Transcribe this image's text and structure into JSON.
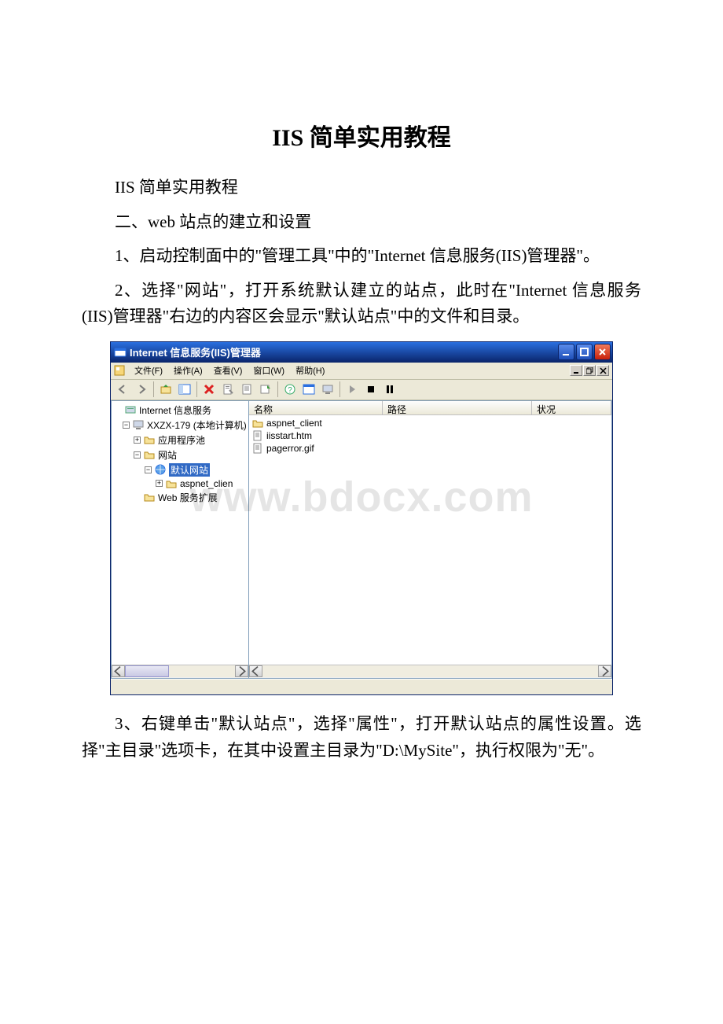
{
  "doc": {
    "title_lat": "IIS",
    "title_cn": " 简单实用教程",
    "p1_lat": "IIS",
    "p1_cn": " 简单实用教程",
    "p2_prefix": "二、",
    "p2_lat": "web",
    "p2_cn": " 站点的建立和设置",
    "p3_a": "1、启动控制面中的\"管理工具\"中的\"",
    "p3_lat": "Internet",
    "p3_b": " 信息服务(",
    "p3_lat2": "IIS",
    "p3_c": ")管理器\"。",
    "p4_a": "2、选择\"网站\"，打开系统默认建立的站点，此时在\"",
    "p4_lat": "Internet",
    "p4_b": " 信息服务(",
    "p4_lat2": "IIS",
    "p4_c": ")管理器\"右边的内容区会显示\"默认站点\"中的文件和目录。",
    "p5_a": "3、右键单击\"默认站点\"，选择\"属性\"，打开默认站点的属性设置。选择\"主目录\"选项卡，在其中设置主目录为\"",
    "p5_lat": "D:\\MySite",
    "p5_b": "\"，执行权限为\"无\"。"
  },
  "watermark": "www.bdocx.com",
  "window": {
    "title": "Internet 信息服务(IIS)管理器",
    "menus": {
      "file": "文件(F)",
      "action": "操作(A)",
      "view": "查看(V)",
      "window": "窗口(W)",
      "help": "帮助(H)"
    },
    "tree": {
      "root": "Internet 信息服务",
      "computer": "XXZX-179 (本地计算机)",
      "apppool": "应用程序池",
      "sites": "网站",
      "default_site": "默认网站",
      "aspnet_client": "aspnet_clien",
      "webext": "Web 服务扩展"
    },
    "list": {
      "cols": {
        "name": "名称",
        "path": "路径",
        "status": "状况"
      },
      "rows": [
        {
          "icon": "folder",
          "name": "aspnet_client"
        },
        {
          "icon": "file",
          "name": "iisstart.htm"
        },
        {
          "icon": "file",
          "name": "pagerror.gif"
        }
      ]
    }
  }
}
